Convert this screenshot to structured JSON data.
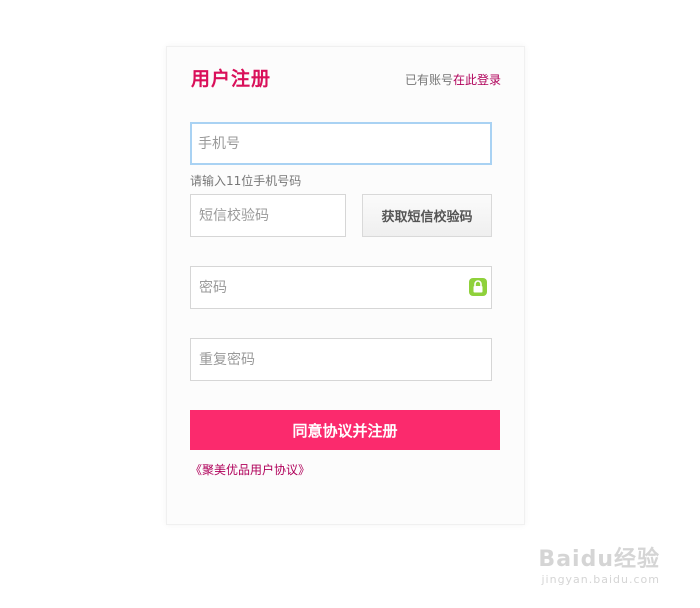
{
  "header": {
    "title": "用户注册",
    "login_prefix": "已有账号",
    "login_link": "在此登录"
  },
  "form": {
    "phone_placeholder": "手机号",
    "phone_hint": "请输入11位手机号码",
    "sms_placeholder": "短信校验码",
    "sms_button": "获取短信校验码",
    "password_placeholder": "密码",
    "confirm_placeholder": "重复密码",
    "submit_label": "同意协议并注册",
    "agreement_link": "《聚美优品用户协议》"
  },
  "watermark": {
    "text_top": "Baidu经验",
    "text_bottom": "jingyan.baidu.com"
  },
  "colors": {
    "accent": "#fb2a6d",
    "title": "#d9105a",
    "link": "#b0005a",
    "lock_icon": "#8fd13b",
    "focus_border": "#a9d2f3"
  }
}
